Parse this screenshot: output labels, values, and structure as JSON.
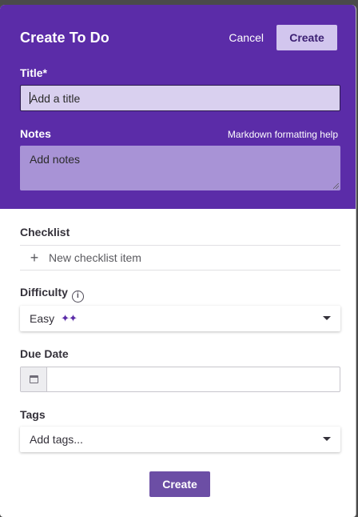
{
  "header": {
    "title": "Create To Do",
    "cancel_label": "Cancel",
    "create_label": "Create"
  },
  "title_field": {
    "label": "Title*",
    "placeholder": "Add a title"
  },
  "notes_field": {
    "label": "Notes",
    "help_link": "Markdown formatting help",
    "placeholder": "Add notes"
  },
  "checklist": {
    "label": "Checklist",
    "new_item_placeholder": "New checklist item",
    "add_icon": "plus-icon"
  },
  "difficulty": {
    "label": "Difficulty",
    "info_icon": "info-icon",
    "selected": "Easy",
    "sparkles": "✦✦"
  },
  "due_date": {
    "label": "Due Date",
    "value": "",
    "icon": "calendar-icon"
  },
  "tags": {
    "label": "Tags",
    "placeholder": "Add tags..."
  },
  "footer": {
    "create_label": "Create"
  },
  "colors": {
    "header_bg": "#5b2ca8",
    "accent": "#6c4ea5",
    "notes_bg": "#a893d6",
    "title_input_bg": "#d9d0ef"
  }
}
